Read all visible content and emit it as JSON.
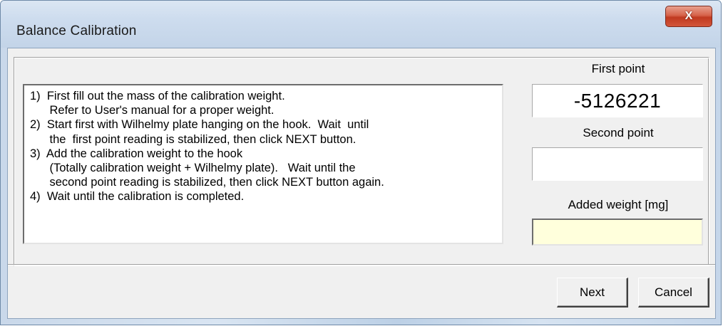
{
  "window": {
    "title": "Balance Calibration",
    "close_glyph": "X"
  },
  "instructions": [
    "1)  First fill out the mass of the calibration weight.",
    "      Refer to User's manual for a proper weight.",
    "2)  Start first with Wilhelmy plate hanging on the hook.  Wait  until",
    "      the  first point reading is stabilized, then click NEXT button.",
    "3)  Add the calibration weight to the hook",
    "      (Totally calibration weight + Wilhelmy plate).   Wait until the",
    "      second point reading is stabilized, then click NEXT button again.",
    "4)  Wait until the calibration is completed."
  ],
  "first_point": {
    "label": "First point",
    "value": "-5126221"
  },
  "second_point": {
    "label": "Second point",
    "value": ""
  },
  "added_weight": {
    "label": "Added weight [mg]",
    "value": ""
  },
  "buttons": {
    "next": "Next",
    "cancel": "Cancel"
  },
  "colors": {
    "input_background": "#ffffdc",
    "close_button": "#c03a20"
  }
}
